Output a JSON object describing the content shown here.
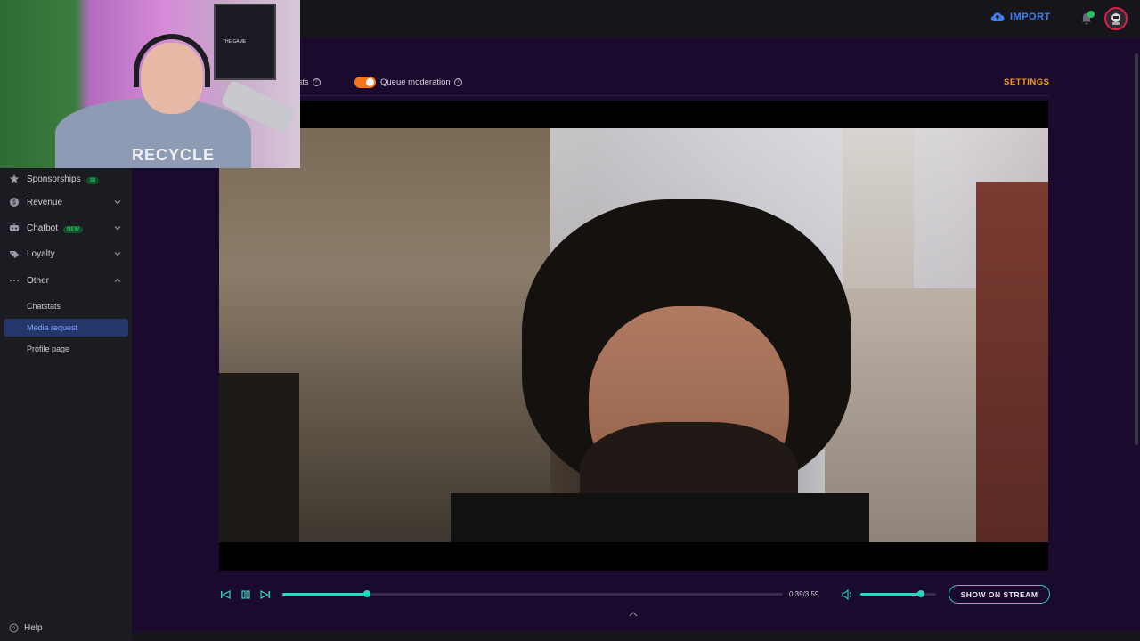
{
  "topbar": {
    "import_label": "IMPORT"
  },
  "sidebar": {
    "items": [
      {
        "label": "Sponsorships",
        "badge": "38",
        "icon": "star-icon"
      },
      {
        "label": "Revenue",
        "icon": "dollar-icon"
      },
      {
        "label": "Chatbot",
        "badge": "NEW",
        "icon": "chatbot-icon"
      },
      {
        "label": "Loyalty",
        "icon": "loyalty-icon"
      },
      {
        "label": "Other",
        "icon": "more-icon"
      }
    ],
    "other_sub": [
      {
        "label": "Chatstats"
      },
      {
        "label": "Media request",
        "active": true
      },
      {
        "label": "Profile page"
      }
    ],
    "help_label": "Help"
  },
  "main": {
    "toggle_partial_label": "sts",
    "queue_moderation_label": "Queue moderation",
    "queue_moderation_on": true,
    "settings_label": "SETTINGS"
  },
  "player": {
    "time": "0:39/3:59",
    "progress": 0.1696,
    "volume": 0.8,
    "show_on_stream_label": "SHOW ON STREAM"
  },
  "webcam": {
    "shirt_text": "RECYCLE",
    "monitor_text": "THE GAME"
  },
  "colors": {
    "accent": "#2dd4bf",
    "settings": "#f59e0b",
    "toggle": "#f97316",
    "import": "#3b82f6",
    "active_nav": "#25366b"
  }
}
